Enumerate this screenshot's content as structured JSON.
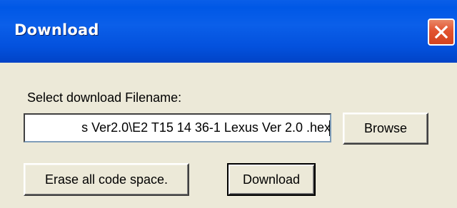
{
  "window": {
    "title": "Download",
    "close_label": "×"
  },
  "form": {
    "filename_label": "Select download Filename:",
    "filename_value": "s Ver2.0\\E2 T15 14 36-1 Lexus Ver 2.0 .hex"
  },
  "buttons": {
    "browse": "Browse",
    "erase": "Erase all code space.",
    "download": "Download"
  },
  "icons": {
    "close": "close-icon"
  },
  "colors": {
    "titlebar": "#0058e6",
    "close_button": "#e2532f",
    "dialog_bg": "#ece9d8"
  }
}
